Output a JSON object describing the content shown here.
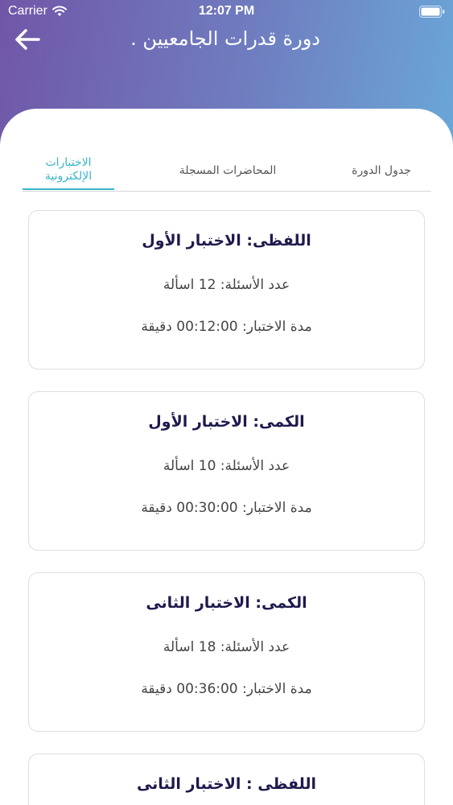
{
  "status_bar": {
    "carrier": "Carrier",
    "time": "12:07 PM"
  },
  "header": {
    "title": "دورة قدرات الجامعيين ."
  },
  "tabs": [
    {
      "label": "الاختبارات الإلكترونية",
      "active": true
    },
    {
      "label": "المحاضرات المسجلة",
      "active": false
    },
    {
      "label": "جدول الدورة",
      "active": false
    }
  ],
  "exams": [
    {
      "title": "اللفظى: الاختبار الأول",
      "questions": "عدد الأسئلة: 12 اسألة",
      "duration": "مدة الاختبار: 00:12:00 دقيقة"
    },
    {
      "title": "الكمى: الاختبار الأول",
      "questions": "عدد الأسئلة: 10 اسألة",
      "duration": "مدة الاختبار: 00:30:00 دقيقة"
    },
    {
      "title": "الكمى: الاختبار الثانى",
      "questions": "عدد الأسئلة: 18 اسألة",
      "duration": "مدة الاختبار: 00:36:00 دقيقة"
    },
    {
      "title": "اللفظى : الاختبار الثانى",
      "questions": "",
      "duration": ""
    }
  ],
  "colors": {
    "accent": "#37b6c8",
    "header_gradient_start": "#7156a8",
    "header_gradient_end": "#6aa7d8",
    "card_title": "#1e1a4d"
  }
}
